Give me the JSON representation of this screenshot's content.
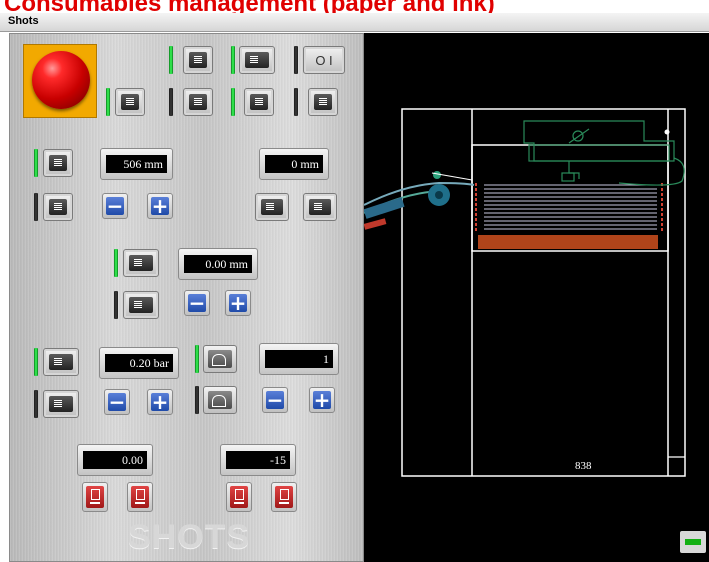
{
  "banner": {
    "title": "Consumables management (paper and ink)"
  },
  "window": {
    "title": "Shots"
  },
  "controls": {
    "paper_width": "506 mm",
    "paper_offset": "0 mm",
    "head_height": "0.00 mm",
    "vacuum_pressure": "0.20 bar",
    "counter": "1",
    "left_adjust": "0.00",
    "right_adjust": "-15",
    "plus_label": "+",
    "minus_label": "−",
    "power_label": "O I"
  },
  "logo": {
    "text": "SHOTS"
  },
  "viewer": {
    "measurement": "838"
  },
  "colors": {
    "accent_red": "#e00000",
    "led_on": "#3aff5a",
    "button_blue": "#1f4aa8",
    "paper_stack": "#b0441a"
  }
}
